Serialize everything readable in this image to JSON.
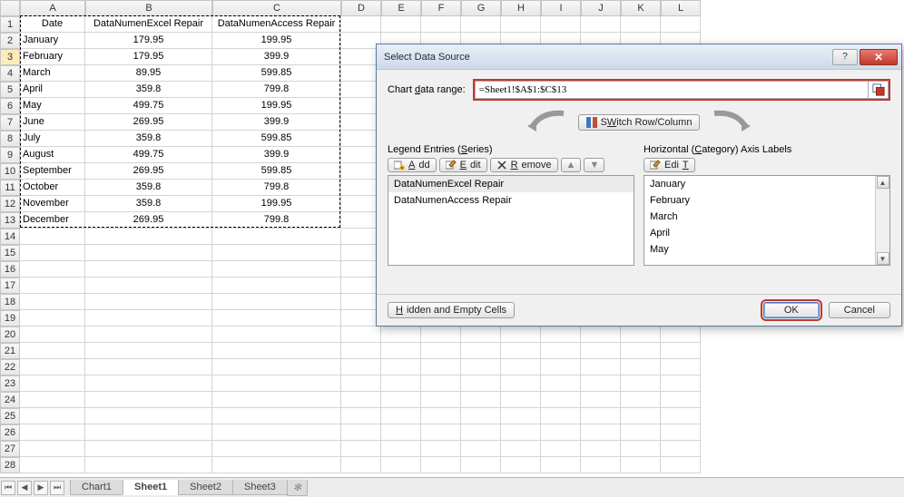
{
  "spreadsheet": {
    "columns": [
      "A",
      "B",
      "C",
      "D",
      "E",
      "F",
      "G",
      "H",
      "I",
      "J",
      "K",
      "L"
    ],
    "headers": {
      "A": "Date",
      "B": "DataNumenExcel Repair",
      "C": "DataNumenAccess Repair"
    },
    "rows": [
      {
        "A": "January",
        "B": "179.95",
        "C": "199.95"
      },
      {
        "A": "February",
        "B": "179.95",
        "C": "399.9"
      },
      {
        "A": "March",
        "B": "89.95",
        "C": "599.85"
      },
      {
        "A": "April",
        "B": "359.8",
        "C": "799.8"
      },
      {
        "A": "May",
        "B": "499.75",
        "C": "199.95"
      },
      {
        "A": "June",
        "B": "269.95",
        "C": "399.9"
      },
      {
        "A": "July",
        "B": "359.8",
        "C": "599.85"
      },
      {
        "A": "August",
        "B": "499.75",
        "C": "399.9"
      },
      {
        "A": "September",
        "B": "269.95",
        "C": "599.85"
      },
      {
        "A": "October",
        "B": "359.8",
        "C": "799.8"
      },
      {
        "A": "November",
        "B": "359.8",
        "C": "199.95"
      },
      {
        "A": "December",
        "B": "269.95",
        "C": "799.8"
      }
    ],
    "selectedRow": 3,
    "totalRows": 28
  },
  "tabs": {
    "sheets": [
      "Chart1",
      "Sheet1",
      "Sheet2",
      "Sheet3"
    ],
    "active": "Sheet1"
  },
  "dialog": {
    "title": "Select Data Source",
    "rangeLabel": "Chart data range:",
    "rangeLabelKey": "d",
    "rangeValue": "=Sheet1!$A$1:$C$13",
    "switchLabel": "Switch Row/Column",
    "switchKey": "W",
    "legend": {
      "title": "Legend Entries (Series)",
      "titleKey": "S",
      "add": "Add",
      "addKey": "A",
      "edit": "Edit",
      "editKey": "E",
      "remove": "Remove",
      "removeKey": "R",
      "items": [
        "DataNumenExcel Repair",
        "DataNumenAccess Repair"
      ]
    },
    "axis": {
      "title": "Horizontal (Category) Axis Labels",
      "titleKey": "C",
      "edit": "Edit",
      "editKey": "T",
      "items": [
        "January",
        "February",
        "March",
        "April",
        "May"
      ]
    },
    "hidden": "Hidden and Empty Cells",
    "hiddenKey": "H",
    "ok": "OK",
    "cancel": "Cancel"
  }
}
